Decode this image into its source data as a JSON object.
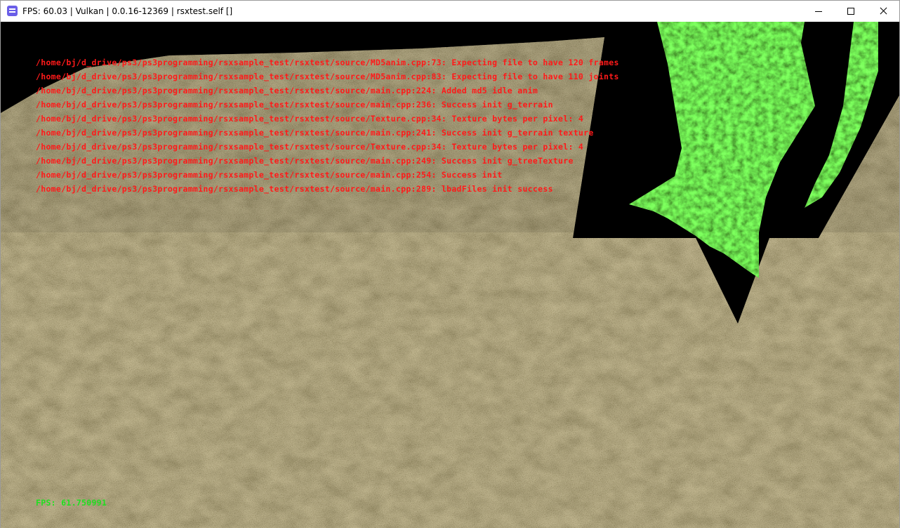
{
  "window": {
    "title": "FPS: 60.03 | Vulkan | 0.0.16-12369 | rsxtest.self []"
  },
  "game": {
    "log_color": "#ff1a1a",
    "log_lines": [
      "/home/bj/d_drive/ps3/ps3programming/rsxsample_test/rsxtest/source/MD5anim.cpp:73: Expecting file to have 120 frames",
      "/home/bj/d_drive/ps3/ps3programming/rsxsample_test/rsxtest/source/MD5anim.cpp:83: Expecting file to have 110 joints",
      "/home/bj/d_drive/ps3/ps3programming/rsxsample_test/rsxtest/source/main.cpp:224: Added md5 idle anim",
      "/home/bj/d_drive/ps3/ps3programming/rsxsample_test/rsxtest/source/main.cpp:236: Success init g_terrain",
      "/home/bj/d_drive/ps3/ps3programming/rsxsample_test/rsxtest/source/Texture.cpp:34: Texture bytes per pixel: 4",
      "/home/bj/d_drive/ps3/ps3programming/rsxsample_test/rsxtest/source/main.cpp:241: Success init g_terrain texture",
      "/home/bj/d_drive/ps3/ps3programming/rsxsample_test/rsxtest/source/Texture.cpp:34: Texture bytes per pixel: 4",
      "/home/bj/d_drive/ps3/ps3programming/rsxsample_test/rsxtest/source/main.cpp:249: Success init g_treeTexture",
      "/home/bj/d_drive/ps3/ps3programming/rsxsample_test/rsxtest/source/main.cpp:254: Success init",
      "/home/bj/d_drive/ps3/ps3programming/rsxsample_test/rsxtest/source/main.cpp:289: lbadFiles init success"
    ],
    "fps_text": "FPS: 61.750991",
    "fps_color": "#1fe01f",
    "terrain_color": "#8e7a4a",
    "foliage_color": "#3aa815"
  }
}
